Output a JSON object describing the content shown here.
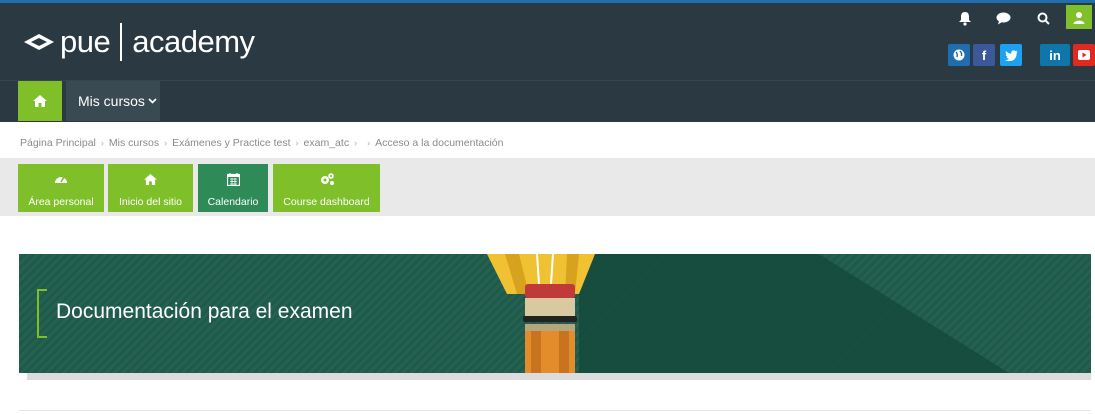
{
  "header": {
    "logo_left": "pue",
    "logo_right": "academy"
  },
  "header_icons": [
    "bell-icon",
    "chat-icon",
    "search-icon",
    "user-icon"
  ],
  "social": {
    "items": [
      {
        "name": "globe",
        "label": ""
      },
      {
        "name": "facebook",
        "label": "f"
      },
      {
        "name": "twitter",
        "label": ""
      },
      {
        "name": "linkedin",
        "label": "in"
      },
      {
        "name": "youtube",
        "label": ""
      }
    ]
  },
  "nav": {
    "mis_cursos": "Mis cursos"
  },
  "breadcrumb": {
    "items": [
      "Página Principal",
      "Mis cursos",
      "Exámenes y Practice test",
      "exam_atc",
      "",
      "Acceso a la documentación"
    ]
  },
  "quick_buttons": [
    {
      "label": "Área personal",
      "icon": "dashboard-icon"
    },
    {
      "label": "Inicio del sitio",
      "icon": "home-icon"
    },
    {
      "label": "Calendario",
      "icon": "calendar-icon"
    },
    {
      "label": "Course dashboard",
      "icon": "cogs-icon"
    }
  ],
  "banner": {
    "title": "Documentación para el examen"
  },
  "colors": {
    "header_bg": "#2b3a42",
    "accent_green": "#7fbf2a",
    "calendar_green": "#2e8b57",
    "banner_bg": "#1d5a4a"
  }
}
